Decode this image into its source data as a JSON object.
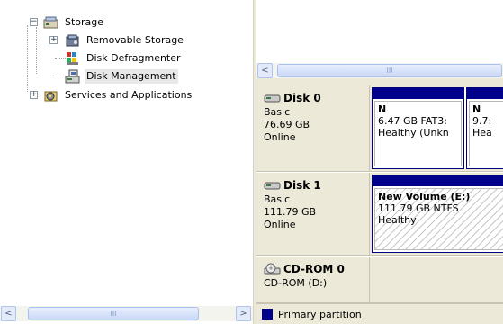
{
  "tree": {
    "items": [
      {
        "label": "Storage",
        "icon": "storage-icon",
        "expander": "−"
      },
      {
        "label": "Removable Storage",
        "icon": "removable-storage-icon",
        "expander": "+"
      },
      {
        "label": "Disk Defragmenter",
        "icon": "disk-defragmenter-icon"
      },
      {
        "label": "Disk Management",
        "icon": "disk-management-icon",
        "selected": true
      },
      {
        "label": "Services and Applications",
        "icon": "services-icon",
        "expander": "+"
      }
    ]
  },
  "scroll": {
    "left_arrow": "<",
    "right_arrow": ">",
    "grip": "III"
  },
  "disks": [
    {
      "name": "Disk 0",
      "type": "Basic",
      "size": "76.69 GB",
      "status": "Online",
      "partitions": [
        {
          "letter": "N",
          "detail": "6.47 GB FAT3:",
          "health": "Healthy (Unkn"
        },
        {
          "letter": "N",
          "detail": "9.7:",
          "health": "Hea"
        }
      ]
    },
    {
      "name": "Disk 1",
      "type": "Basic",
      "size": "111.79 GB",
      "status": "Online",
      "partitions": [
        {
          "title": "New Volume  (E:)",
          "detail": "111.79 GB NTFS",
          "health": "Healthy"
        }
      ]
    },
    {
      "name": "CD-ROM 0",
      "type": "CD-ROM (D:)"
    }
  ],
  "legend": {
    "label": "Primary partition",
    "color": "#00008b"
  },
  "colors": {
    "partition_bar": "#00008b",
    "panel_bg": "#ece9d8"
  }
}
